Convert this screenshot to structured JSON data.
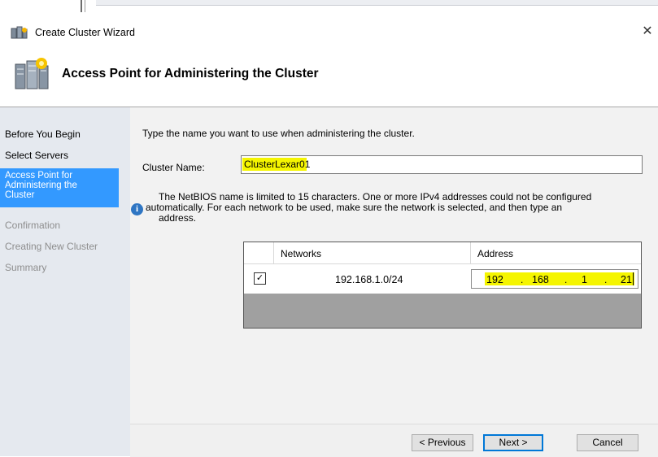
{
  "window": {
    "title": "Create Cluster Wizard",
    "close_label": "✕"
  },
  "header": {
    "title": "Access Point for Administering the Cluster"
  },
  "nav": {
    "items": [
      {
        "label": "Before You Begin",
        "state": "done"
      },
      {
        "label": "Select Servers",
        "state": "done"
      },
      {
        "label": "Access Point for Administering the Cluster",
        "state": "active"
      },
      {
        "label": "Confirmation",
        "state": "disabled"
      },
      {
        "label": "Creating New Cluster",
        "state": "disabled"
      },
      {
        "label": "Summary",
        "state": "disabled"
      }
    ],
    "active_line1": "Access Point for",
    "active_line2": "Administering the",
    "active_line3": "Cluster"
  },
  "main": {
    "instruction": "Type the name you want to use when administering the cluster.",
    "cluster_name_label": "Cluster Name:",
    "cluster_name_value": "ClusterLexar01",
    "info_line1": "The NetBIOS name is limited to 15 characters.  One or more IPv4 addresses could not be configured",
    "info_line2": "automatically.  For each network to be used, make sure the network is selected, and then type an",
    "info_line3": "address.",
    "info_icon": "info-icon"
  },
  "grid": {
    "columns": [
      "Networks",
      "Address"
    ],
    "rows": [
      {
        "checked": true,
        "network": "192.168.1.0/24",
        "address": [
          "192",
          "168",
          "1",
          "21"
        ]
      }
    ]
  },
  "buttons": {
    "previous": "< Previous",
    "next": "Next >",
    "cancel": "Cancel"
  },
  "colors": {
    "nav_bg": "#e5e9ef",
    "nav_active": "#3399ff",
    "highlight": "#f5f500",
    "default_button_border": "#0078d7"
  }
}
